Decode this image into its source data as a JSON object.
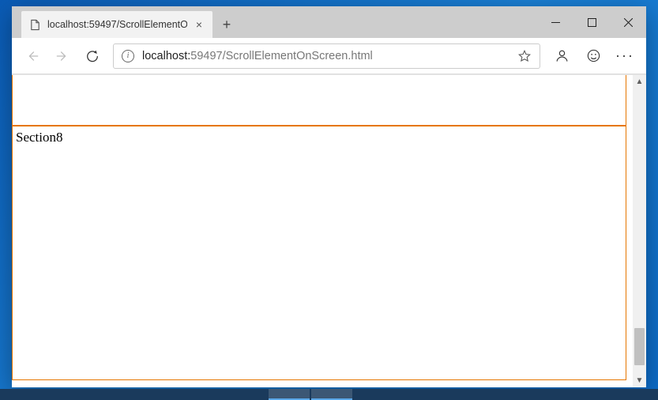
{
  "window": {
    "minimize_tip": "Minimize",
    "maximize_tip": "Maximize",
    "close_tip": "Close"
  },
  "tab": {
    "title": "localhost:59497/ScrollElementO",
    "close_tip": "Close tab"
  },
  "new_tab": {
    "label": "+"
  },
  "nav": {
    "back_tip": "Back",
    "forward_tip": "Forward",
    "refresh_tip": "Refresh"
  },
  "address": {
    "info_glyph": "i",
    "host": "localhost:",
    "port_path": "59497/ScrollElementOnScreen.html",
    "star_tip": "Add to favorites"
  },
  "toolbar_right": {
    "profile_tip": "Profile",
    "feedback_tip": "Feedback",
    "more_tip": "Settings and more"
  },
  "page": {
    "section_label": "Section8"
  },
  "scroll": {
    "up_glyph": "▲",
    "down_glyph": "▼"
  }
}
